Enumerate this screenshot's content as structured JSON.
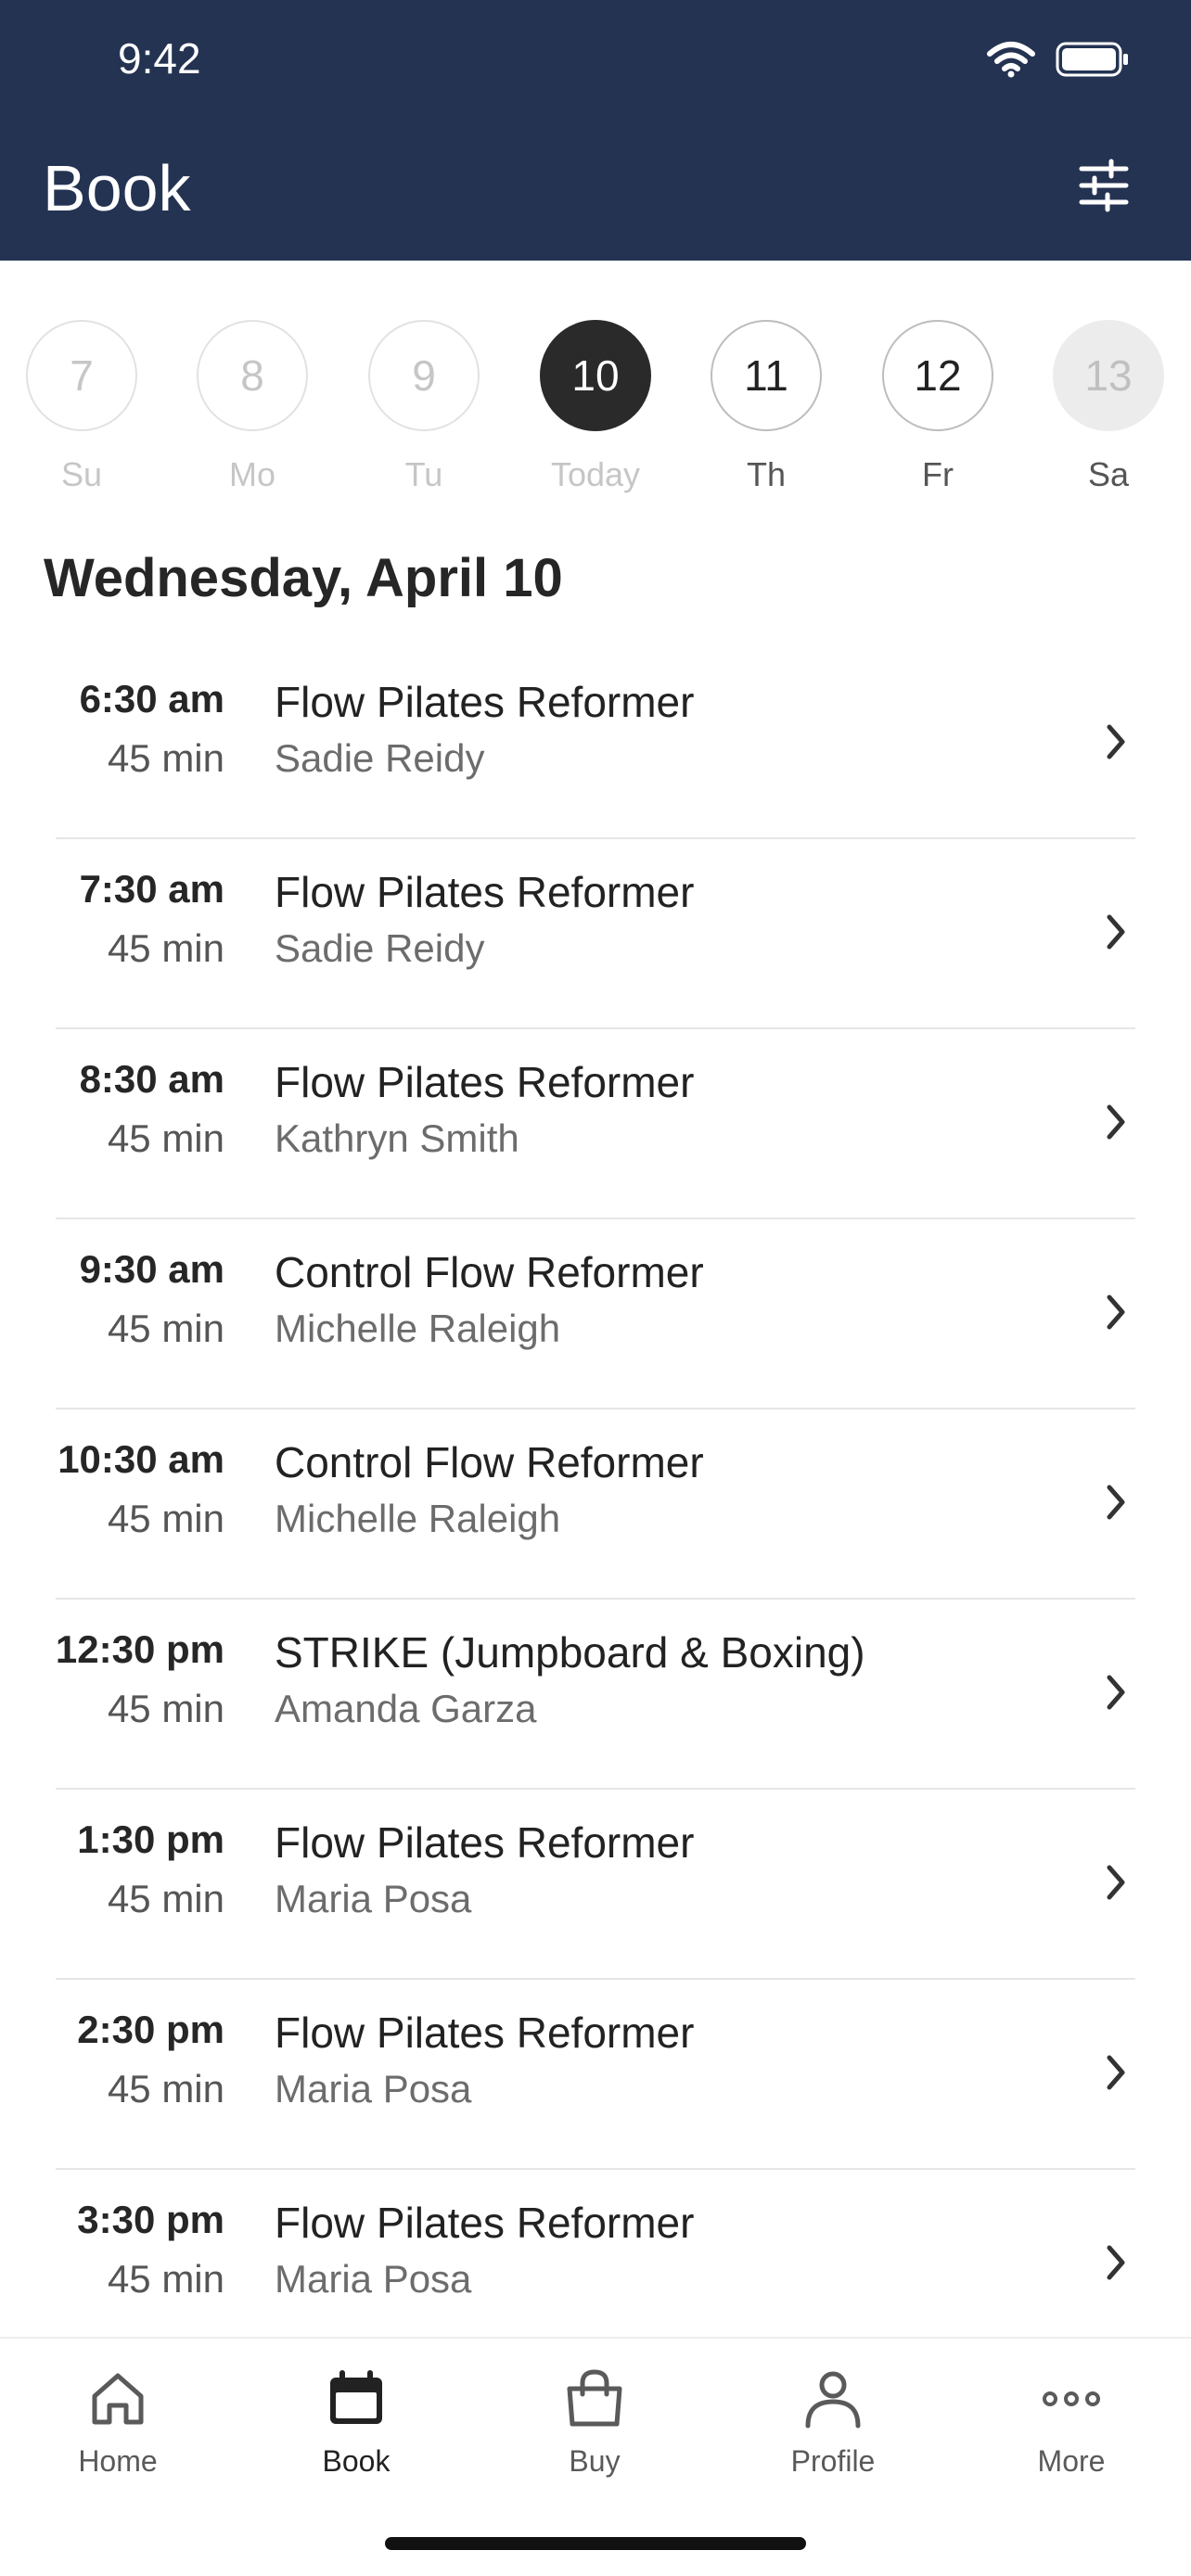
{
  "status_bar": {
    "time": "9:42"
  },
  "header": {
    "title": "Book"
  },
  "date_strip": [
    {
      "num": "7",
      "label": "Su",
      "state": "past"
    },
    {
      "num": "8",
      "label": "Mo",
      "state": "past"
    },
    {
      "num": "9",
      "label": "Tu",
      "state": "past"
    },
    {
      "num": "10",
      "label": "Today",
      "state": "active"
    },
    {
      "num": "11",
      "label": "Th",
      "state": "future"
    },
    {
      "num": "12",
      "label": "Fr",
      "state": "future"
    },
    {
      "num": "13",
      "label": "Sa",
      "state": "disabled"
    }
  ],
  "date_heading": "Wednesday, April 10",
  "classes": [
    {
      "time": "6:30 am",
      "duration": "45 min",
      "name": "Flow Pilates Reformer",
      "teacher": "Sadie Reidy"
    },
    {
      "time": "7:30 am",
      "duration": "45 min",
      "name": "Flow Pilates Reformer",
      "teacher": "Sadie Reidy"
    },
    {
      "time": "8:30 am",
      "duration": "45 min",
      "name": "Flow Pilates Reformer",
      "teacher": "Kathryn Smith"
    },
    {
      "time": "9:30 am",
      "duration": "45 min",
      "name": "Control Flow Reformer",
      "teacher": "Michelle Raleigh"
    },
    {
      "time": "10:30 am",
      "duration": "45 min",
      "name": "Control Flow Reformer",
      "teacher": "Michelle Raleigh"
    },
    {
      "time": "12:30 pm",
      "duration": "45 min",
      "name": "STRIKE (Jumpboard & Boxing)",
      "teacher": "Amanda Garza"
    },
    {
      "time": "1:30 pm",
      "duration": "45 min",
      "name": "Flow Pilates Reformer",
      "teacher": "Maria Posa"
    },
    {
      "time": "2:30 pm",
      "duration": "45 min",
      "name": "Flow Pilates Reformer",
      "teacher": "Maria Posa"
    },
    {
      "time": "3:30 pm",
      "duration": "45 min",
      "name": "Flow Pilates Reformer",
      "teacher": "Maria Posa"
    }
  ],
  "tabbar": {
    "items": [
      {
        "label": "Home",
        "icon": "home-icon"
      },
      {
        "label": "Book",
        "icon": "calendar-icon",
        "active": true
      },
      {
        "label": "Buy",
        "icon": "shopping-bag-icon"
      },
      {
        "label": "Profile",
        "icon": "person-icon"
      },
      {
        "label": "More",
        "icon": "more-dots-icon"
      }
    ]
  },
  "colors": {
    "header_bg": "#243352",
    "active_day": "#2a2a2a"
  }
}
